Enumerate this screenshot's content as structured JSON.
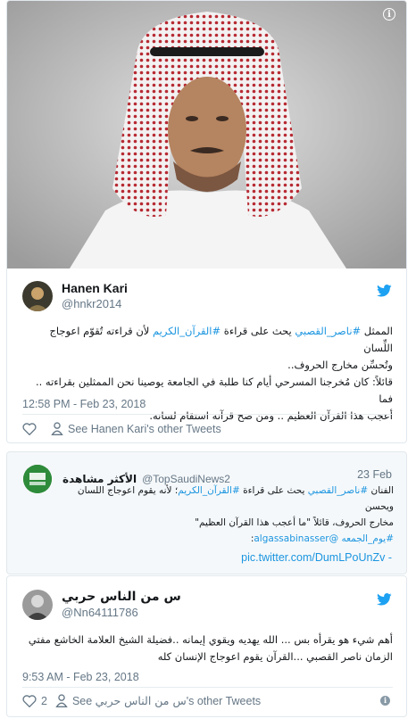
{
  "tweet1": {
    "display_name": "Hanen Kari",
    "handle": "@hnkr2014",
    "text_line1_a": "الممثل ",
    "text_tag1": "#ناصر_القصبي",
    "text_line1_b": " يحث على قراءة ",
    "text_tag2": "#القرآن_الكريم",
    "text_line1_c": " لأن قراءته تُقوّم اعوجاج اللِّسان",
    "text_line2": "وتُحسِّن مخارج الحروف..",
    "text_line3": "قائلاً: كان مُخرجنا المسرحي أيام كنا طلبة في الجامعة يوصينا نحن الممثلين بقراءته .. فما",
    "text_line4": "أعجب هذا القرآن العظيم .. ومن صح قرآنه استقام لسانه.",
    "timestamp": "12:58 PM - Feb 23, 2018",
    "see_other": "See Hanen Kari's other Tweets",
    "icons": {
      "info": "info-icon",
      "bird": "twitter-bird-icon",
      "heart": "heart-icon",
      "person": "person-icon"
    }
  },
  "quote": {
    "display_name": "الأكثر مشاهدة",
    "handle": "@TopSaudiNews2",
    "date": "23 Feb",
    "avatar_text": "الأكثر مشاهدة",
    "line1_a": "الفنان ",
    "line1_tag1": "#ناصر_القصبي",
    "line1_b": " يحث على قراءة ",
    "line1_tag2": "#القرآن_الكريم",
    "line1_c": "؛ لأنه يقوم اعوجاج اللسان ويحسن",
    "line2": "مخارج الحروف، قائلاً \"ما أعجب هذا القرآن العظيم\"",
    "line3_tag1": "#يوم_الجمعه",
    "line3_mention": "@algassabinasser",
    "line3_end": ":",
    "link": "pic.twitter.com/DumLPoUnZv",
    "link_prefix": "- "
  },
  "tweet2": {
    "display_name": "س من الناس حربي",
    "handle": "@Nn64111786",
    "text_line1": "أهم شيء هو يقرأه بس ... الله يهديه ويقوي إيمانه ..فضيلة الشيخ العلامة الخاشع مفتي",
    "text_line2": "الزمان  ناصر القصبي   ...القرآن يقوم اعوجاج الإنسان كله",
    "timestamp": "9:53 AM - Feb 23, 2018",
    "likes": "2",
    "see_prefix": "See ",
    "see_name": "س من الناس حربي",
    "see_suffix": "'s other Tweets"
  },
  "colors": {
    "link": "#1b95e0",
    "muted": "#657786",
    "border": "#e1e8ed",
    "quote_bg": "#f5f8fa"
  }
}
